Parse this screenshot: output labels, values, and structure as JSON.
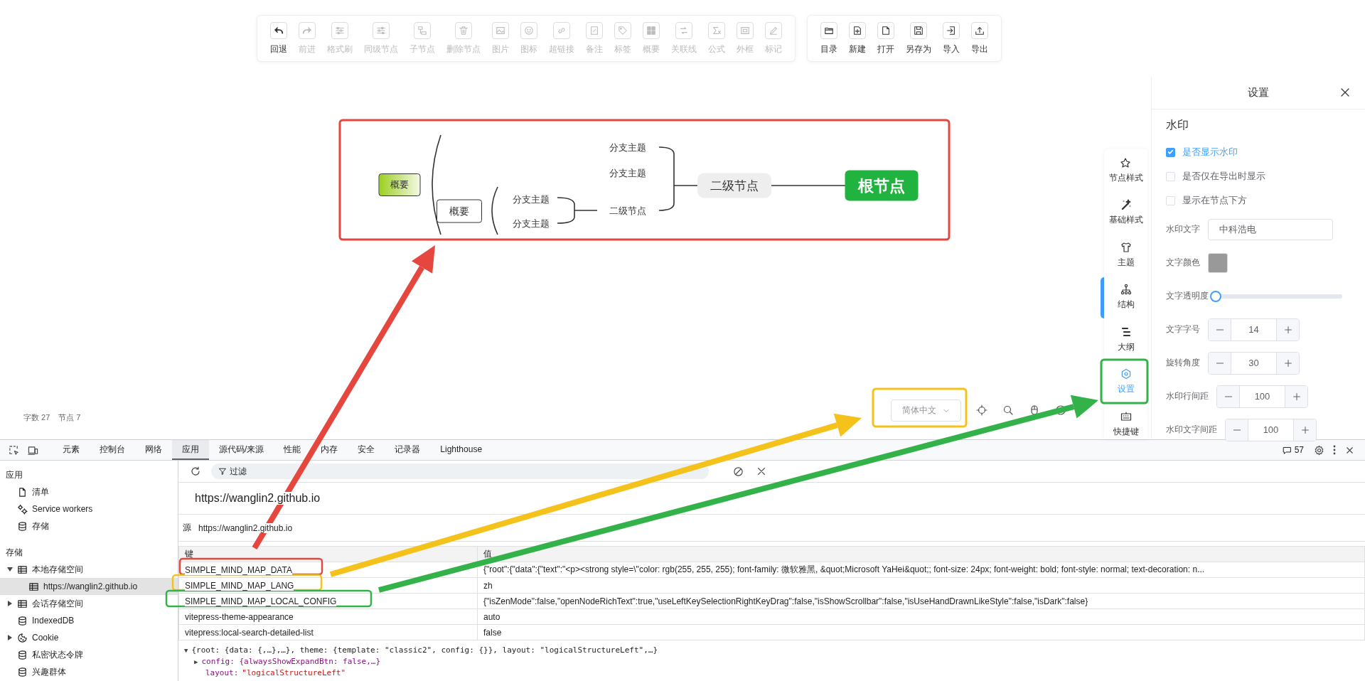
{
  "toolbar": {
    "groups": [
      {
        "items": [
          {
            "label": "回退",
            "disabled": false
          },
          {
            "label": "前进",
            "disabled": true
          },
          {
            "label": "格式刷",
            "disabled": true
          },
          {
            "label": "同级节点",
            "disabled": true
          },
          {
            "label": "子节点",
            "disabled": true
          },
          {
            "label": "删除节点",
            "disabled": true
          },
          {
            "label": "图片",
            "disabled": true
          },
          {
            "label": "图标",
            "disabled": true
          },
          {
            "label": "超链接",
            "disabled": true
          },
          {
            "label": "备注",
            "disabled": true
          },
          {
            "label": "标签",
            "disabled": true
          },
          {
            "label": "概要",
            "disabled": true
          },
          {
            "label": "关联线",
            "disabled": true
          },
          {
            "label": "公式",
            "disabled": true
          },
          {
            "label": "外框",
            "disabled": true
          },
          {
            "label": "标记",
            "disabled": true
          }
        ]
      },
      {
        "items": [
          {
            "label": "目录",
            "disabled": false
          },
          {
            "label": "新建",
            "disabled": false
          },
          {
            "label": "打开",
            "disabled": false
          },
          {
            "label": "另存为",
            "disabled": false
          },
          {
            "label": "导入",
            "disabled": false
          },
          {
            "label": "导出",
            "disabled": false
          }
        ]
      }
    ]
  },
  "mind_map": {
    "nodes": [
      {
        "text": "概要",
        "kind": "summary_active"
      },
      {
        "text": "概要",
        "kind": "summary"
      },
      {
        "text": "分支主题",
        "kind": "branch"
      },
      {
        "text": "分支主题",
        "kind": "branch"
      },
      {
        "text": "分支主题",
        "kind": "branch"
      },
      {
        "text": "分支主题",
        "kind": "branch"
      },
      {
        "text": "二级节点",
        "kind": "branch"
      },
      {
        "text": "二级节点",
        "kind": "second"
      },
      {
        "text": "根节点",
        "kind": "root"
      }
    ]
  },
  "side_tabs": [
    {
      "label": "节点样式",
      "selected": false
    },
    {
      "label": "基础样式",
      "selected": false
    },
    {
      "label": "主题",
      "selected": false
    },
    {
      "label": "结构",
      "selected": false
    },
    {
      "label": "大纲",
      "selected": false
    },
    {
      "label": "设置",
      "selected": true
    },
    {
      "label": "快捷键",
      "selected": false
    }
  ],
  "settings_panel": {
    "title": "设置",
    "section": "水印",
    "checkboxes": [
      {
        "label": "是否显示水印",
        "checked": true
      },
      {
        "label": "是否仅在导出时显示",
        "checked": false
      },
      {
        "label": "显示在节点下方",
        "checked": false
      }
    ],
    "text_field": {
      "label": "水印文字",
      "value": "中科浩电"
    },
    "color_field": {
      "label": "文字颜色",
      "color": "#999999"
    },
    "slider": {
      "label": "文字透明度",
      "level": 0
    },
    "number_fields": [
      {
        "label": "文字字号",
        "value": "14"
      },
      {
        "label": "旋转角度",
        "value": "30"
      },
      {
        "label": "水印行间距",
        "value": "100"
      },
      {
        "label": "水印文字间距",
        "value": "100"
      }
    ]
  },
  "status_bar": {
    "word_count": "字数 27",
    "node_count": "节点 7",
    "language": "简体中文"
  },
  "devtools": {
    "tabs": [
      {
        "label": "元素",
        "selected": false
      },
      {
        "label": "控制台",
        "selected": false
      },
      {
        "label": "网络",
        "selected": false
      },
      {
        "label": "应用",
        "selected": true
      },
      {
        "label": "源代码/来源",
        "selected": false
      },
      {
        "label": "性能",
        "selected": false
      },
      {
        "label": "内存",
        "selected": false
      },
      {
        "label": "安全",
        "selected": false
      },
      {
        "label": "记录器",
        "selected": false
      },
      {
        "label": "Lighthouse",
        "selected": false
      }
    ],
    "message_count": "57",
    "sidebar": {
      "sections": [
        {
          "title": "应用",
          "items": [
            {
              "label": "清单",
              "kind": "file"
            },
            {
              "label": "Service workers",
              "kind": "gears"
            },
            {
              "label": "存储",
              "kind": "database"
            }
          ]
        },
        {
          "title": "存储",
          "items": [
            {
              "label": "本地存储空间",
              "kind": "table",
              "expanded": true,
              "children": [
                {
                  "label": "https://wanglin2.github.io",
                  "kind": "table",
                  "selected": true
                }
              ]
            },
            {
              "label": "会话存储空间",
              "kind": "table",
              "expanded": false
            },
            {
              "label": "IndexedDB",
              "kind": "database"
            },
            {
              "label": "Cookie",
              "kind": "cookie",
              "expanded": false
            },
            {
              "label": "私密状态令牌",
              "kind": "database"
            },
            {
              "label": "兴趣群体",
              "kind": "database"
            }
          ]
        }
      ]
    },
    "filter": {
      "placeholder": "过滤"
    },
    "origin_title": "https://wanglin2.github.io",
    "origin_label": "源",
    "origin_value": "https://wanglin2.github.io",
    "table": {
      "columns": [
        "键",
        "值"
      ],
      "rows": [
        {
          "key": "SIMPLE_MIND_MAP_DATA",
          "value": "{\"root\":{\"data\":{\"text\":\"<p><strong style=\\\"color: rgb(255, 255, 255); font-family: 微软雅黑, &quot;Microsoft YaHei&quot;; font-size: 24px; font-weight: bold; font-style: normal; text-decoration: n..."
        },
        {
          "key": "SIMPLE_MIND_MAP_LANG",
          "value": "zh"
        },
        {
          "key": "SIMPLE_MIND_MAP_LOCAL_CONFIG",
          "value": "{\"isZenMode\":false,\"openNodeRichText\":true,\"useLeftKeySelectionRightKeyDrag\":false,\"isShowScrollbar\":false,\"isUseHandDrawnLikeStyle\":false,\"isDark\":false}"
        },
        {
          "key": "vitepress-theme-appearance",
          "value": "auto"
        },
        {
          "key": "vitepress:local-search-detailed-list",
          "value": "false"
        }
      ]
    },
    "preview": {
      "root_toggle": "▼",
      "config_toggle": "▶",
      "root_line": "{root: {data: {,…},…}, theme: {template: \"classic2\", config: {}}, layout: \"logicalStructureLeft\",…}",
      "config_line": "config: {alwaysShowExpandBtn: false,…}",
      "layout_key": "layout:",
      "layout_value": "\"logicalStructureLeft\""
    }
  },
  "annotations": [
    {
      "color": "#e5473f"
    },
    {
      "color": "#f5c21b"
    },
    {
      "color": "#33b24a"
    }
  ]
}
